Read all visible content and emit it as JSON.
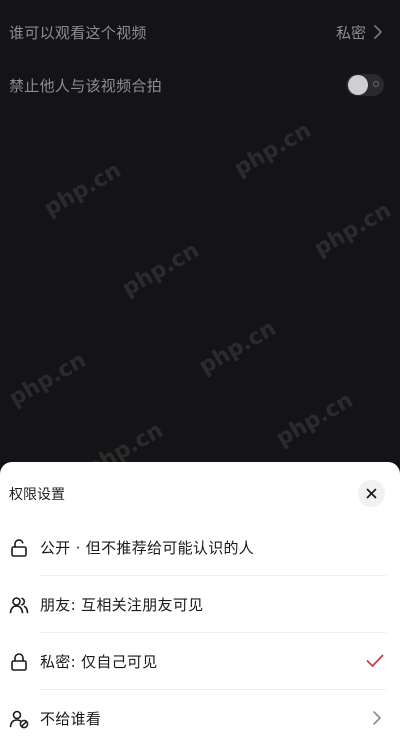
{
  "settings": {
    "who_can_view": {
      "label": "谁可以观看这个视频",
      "value": "私密"
    },
    "disable_duet": {
      "label": "禁止他人与该视频合拍",
      "enabled": false
    }
  },
  "watermark": {
    "text": "php.cn"
  },
  "permission_sheet": {
    "title": "权限设置",
    "options": [
      {
        "label": "公开 · 但不推荐给可能认识的人",
        "icon": "unlock-icon",
        "selected": false
      },
      {
        "label": "朋友: 互相关注朋友可见",
        "icon": "friends-icon",
        "selected": false
      },
      {
        "label": "私密: 仅自己可见",
        "icon": "lock-icon",
        "selected": true
      },
      {
        "label": "不给谁看",
        "icon": "block-user-icon",
        "selected": false
      }
    ]
  },
  "colors": {
    "check": "#c7414f",
    "dark_bg": "#141416",
    "sheet_bg": "#ffffff"
  }
}
